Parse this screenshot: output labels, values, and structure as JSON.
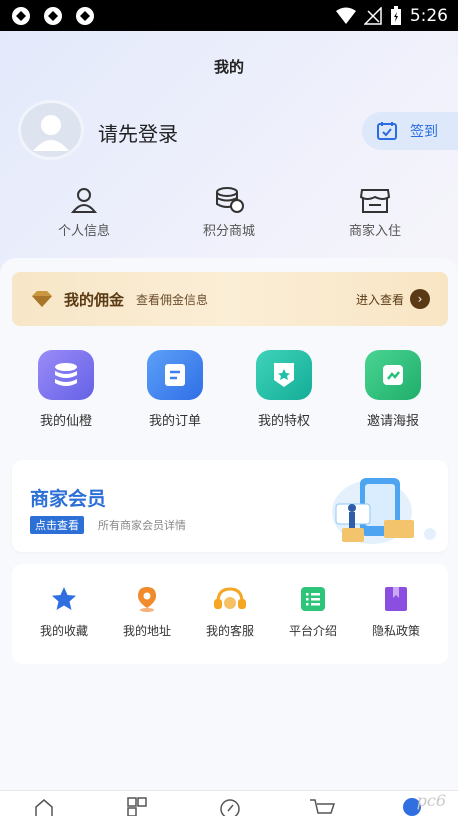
{
  "status_bar": {
    "time": "5:26"
  },
  "header": {
    "title": "我的"
  },
  "user": {
    "login_prompt": "请先登录"
  },
  "checkin": {
    "label": "签到"
  },
  "quick_links": [
    {
      "label": "个人信息",
      "icon": "person-icon"
    },
    {
      "label": "积分商城",
      "icon": "coins-icon"
    },
    {
      "label": "商家入住",
      "icon": "store-icon"
    }
  ],
  "commission": {
    "title": "我的佣金",
    "subtitle": "查看佣金信息",
    "action": "进入查看"
  },
  "features": [
    {
      "label": "我的仙橙",
      "icon": "database-icon",
      "color": "#7b78f0"
    },
    {
      "label": "我的订单",
      "icon": "order-icon",
      "color": "#3d7ef0"
    },
    {
      "label": "我的特权",
      "icon": "privilege-icon",
      "color": "#22bfa7"
    },
    {
      "label": "邀请海报",
      "icon": "poster-icon",
      "color": "#27c17e"
    }
  ],
  "merchant": {
    "title": "商家会员",
    "badge": "点击查看",
    "description": "所有商家会员详情"
  },
  "services": [
    {
      "label": "我的收藏",
      "icon": "star-icon",
      "color": "#2f6fe0"
    },
    {
      "label": "我的地址",
      "icon": "location-icon",
      "color": "#f08a2b"
    },
    {
      "label": "我的客服",
      "icon": "headset-icon",
      "color": "#f5a623"
    },
    {
      "label": "平台介绍",
      "icon": "list-icon",
      "color": "#2ec47a"
    },
    {
      "label": "隐私政策",
      "icon": "bookmark-icon",
      "color": "#8a4fe0"
    }
  ],
  "colors": {
    "primary": "#2c6fd6",
    "commission_text": "#5a3a14"
  },
  "watermark": "pc6"
}
